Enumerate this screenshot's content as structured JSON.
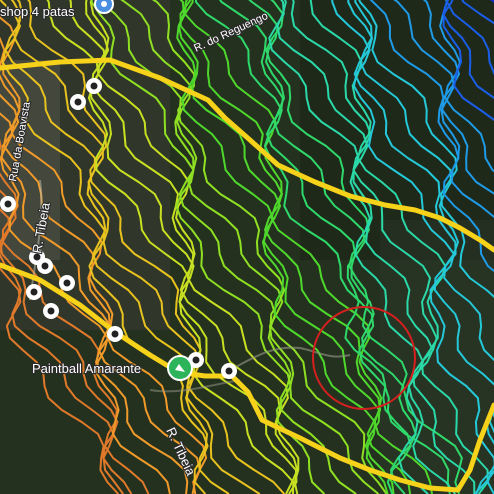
{
  "map": {
    "labels": {
      "shop": "shop 4 patas",
      "road_reguengo": "R. do Reguengo",
      "road_boavista": "Rua da Boavista",
      "road_tibeia_w": "R. Tibeia",
      "road_tibeia_s": "R. Tibeia",
      "paintball": "Paintball Amarante"
    },
    "colors": {
      "main_road": "#f7d21a",
      "highlight_circle": "#d4201f",
      "poi_fill": "#ffffff",
      "poi_center": "#222222",
      "poi_green": "#2db35a"
    },
    "contour_palette": [
      "#e07a2a",
      "#f09a2a",
      "#e8c21e",
      "#c8e022",
      "#8fe022",
      "#4fd82c",
      "#2fd86a",
      "#2ad8a8",
      "#24c8d8",
      "#1e9ae6",
      "#1a5ee8",
      "#1030d0"
    ]
  }
}
